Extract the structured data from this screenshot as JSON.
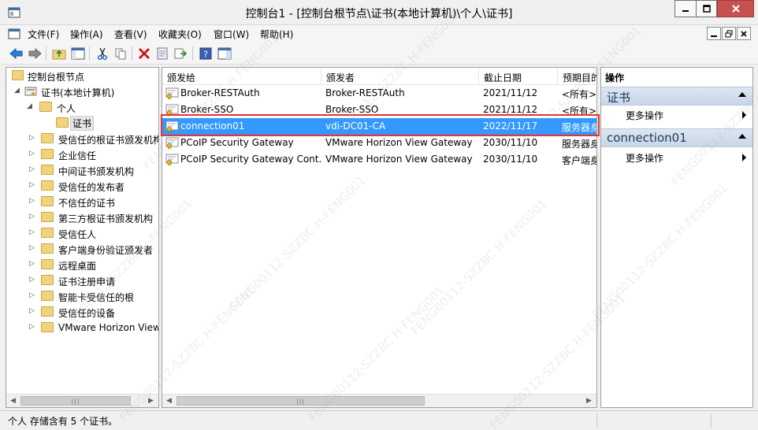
{
  "window": {
    "title": "控制台1 - [控制台根节点\\证书(本地计算机)\\个人\\证书]"
  },
  "menu": [
    "文件(F)",
    "操作(A)",
    "查看(V)",
    "收藏夹(O)",
    "窗口(W)",
    "帮助(H)"
  ],
  "tree": {
    "root": "控制台根节点",
    "computer": "证书(本地计算机)",
    "personal": "个人",
    "certs": "证书",
    "stores": [
      "受信任的根证书颁发机构",
      "企业信任",
      "中间证书颁发机构",
      "受信任的发布者",
      "不信任的证书",
      "第三方根证书颁发机构",
      "受信任人",
      "客户端身份验证颁发者",
      "远程桌面",
      "证书注册申请",
      "智能卡受信任的根",
      "受信任的设备",
      "VMware Horizon View Certificates"
    ]
  },
  "table": {
    "columns": [
      "颁发给",
      "颁发者",
      "截止日期",
      "预期目的"
    ],
    "rows": [
      {
        "issued_to": "Broker-RESTAuth",
        "issuer": "Broker-RESTAuth",
        "expires": "2021/11/12",
        "purpose": "<所有>"
      },
      {
        "issued_to": "Broker-SSO",
        "issuer": "Broker-SSO",
        "expires": "2021/11/12",
        "purpose": "<所有>"
      },
      {
        "issued_to": "connection01",
        "issuer": "vdi-DC01-CA",
        "expires": "2022/11/17",
        "purpose": "服务器身份验证"
      },
      {
        "issued_to": "PCoIP Security Gateway",
        "issuer": "VMware Horizon View Gateway",
        "expires": "2030/11/10",
        "purpose": "服务器身份验证"
      },
      {
        "issued_to": "PCoIP Security Gateway Cont...",
        "issuer": "VMware Horizon View Gateway",
        "expires": "2030/11/10",
        "purpose": "客户端身份验证"
      }
    ]
  },
  "actions": {
    "title": "操作",
    "sections": [
      {
        "title": "证书",
        "item": "更多操作"
      },
      {
        "title": "connection01",
        "item": "更多操作"
      }
    ]
  },
  "status": {
    "text": "个人 存储含有 5 个证书。"
  },
  "watermark": {
    "text": "FENG00112-SZZBC H-FENG001"
  },
  "colors": {
    "selection": "#3399ff",
    "highlight_box": "#e83232",
    "close_button": "#c75050",
    "action_header": "#c8d6e8"
  }
}
